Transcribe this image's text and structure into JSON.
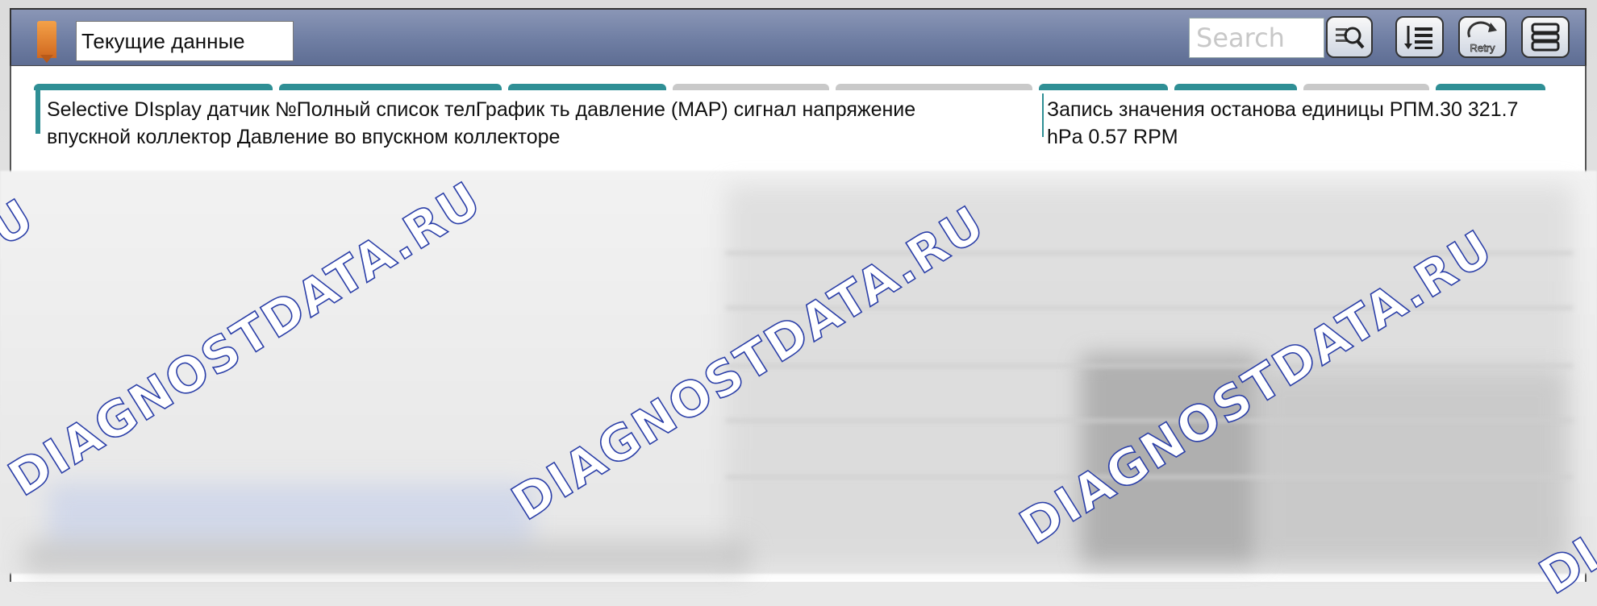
{
  "window": {
    "title": "Текущие данные",
    "search_placeholder": "Search"
  },
  "toolbar": {
    "retry_label": "Retry",
    "icons": [
      "magnifier-icon",
      "list-icon",
      "retry-icon",
      "menu-icon"
    ]
  },
  "tabs": {
    "line1": "Selective DIsplay датчик №Полный список телГрафик  ть давление (MAP) сигнал напряжение",
    "line2": "впускной коллектор Давление во впускном коллекторе",
    "selected_line1": "Запись значения останова единицы РПМ.30 321.7",
    "selected_line2": "hPa 0.57 RPM"
  },
  "watermark": {
    "text": "DIAGNOSTDATA.RU",
    "edge_left": "U",
    "edge_right": "DI"
  },
  "colors": {
    "titlebar": "#6f7ea3",
    "tab_accent": "#2f8f95",
    "tab_inactive": "#c9c9c9",
    "watermark_outline": "#2b3fa8",
    "marker": "#e8883a"
  }
}
